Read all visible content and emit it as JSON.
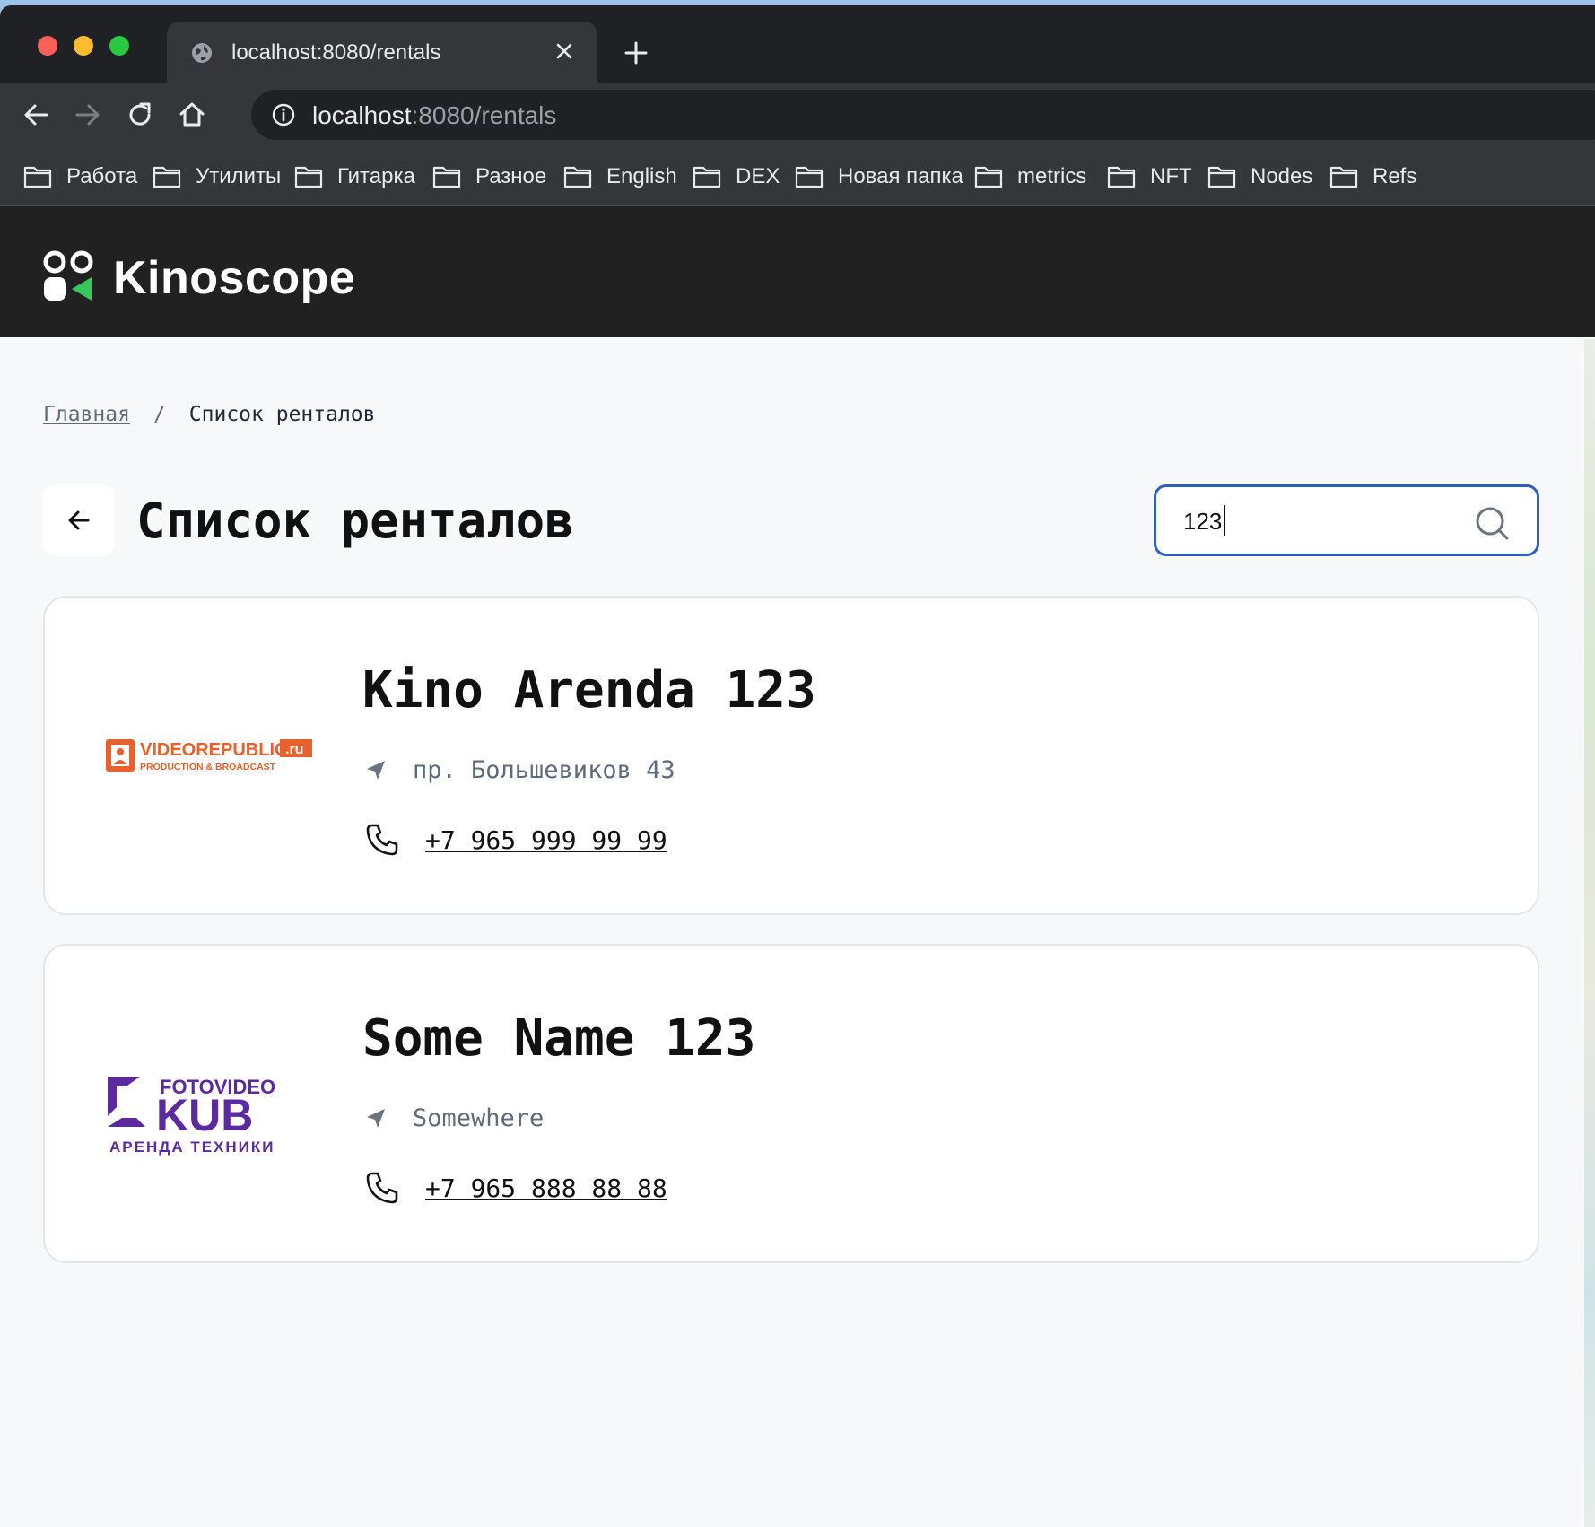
{
  "browser": {
    "tab_title": "localhost:8080/rentals",
    "url_host": "localhost",
    "url_rest": ":8080/rentals",
    "bookmarks": [
      "Работа",
      "Утилиты",
      "Гитарка",
      "Разное",
      "English",
      "DEX",
      "Новая папка",
      "metrics",
      "NFT",
      "Nodes",
      "Refs"
    ]
  },
  "site": {
    "brand": "Kinoscope"
  },
  "breadcrumb": {
    "home": "Главная",
    "separator": "/",
    "current": "Список ренталов"
  },
  "page": {
    "title": "Список ренталов"
  },
  "search": {
    "value": "123"
  },
  "rentals": [
    {
      "name": "Kino Arenda 123",
      "address": "пр. Большевиков 43",
      "phone": "+7 965 999 99 99",
      "logo": {
        "line1": "VIDEOREPUBLIC",
        "badge": ".ru",
        "line2": "PRODUCTION & BROADCAST",
        "color": "#e8612c"
      }
    },
    {
      "name": "Some Name 123",
      "address": "Somewhere",
      "phone": "+7 965 888 88 88",
      "logo": {
        "line1": "FOTOVIDEO",
        "line2": "KUB",
        "line3": "АРЕНДА ТЕХНИКИ",
        "color": "#5b2a9e"
      }
    }
  ],
  "colors": {
    "accent": "#2f5fbf",
    "brand_green": "#34c759",
    "header_bg": "#212121"
  }
}
